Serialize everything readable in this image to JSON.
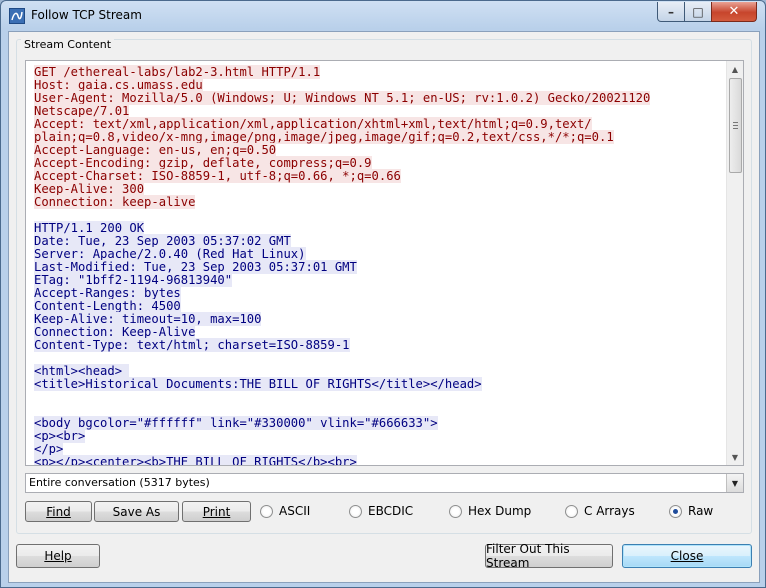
{
  "window": {
    "title": "Follow TCP Stream",
    "min_glyph": "–",
    "max_glyph": "□",
    "close_glyph": "✕"
  },
  "group": {
    "label": "Stream Content"
  },
  "stream": {
    "request": [
      "GET /ethereal-labs/lab2-3.html HTTP/1.1",
      "Host: gaia.cs.umass.edu",
      "User-Agent: Mozilla/5.0 (Windows; U; Windows NT 5.1; en-US; rv:1.0.2) Gecko/20021120",
      "Netscape/7.01",
      "Accept: text/xml,application/xml,application/xhtml+xml,text/html;q=0.9,text/",
      "plain;q=0.8,video/x-mng,image/png,image/jpeg,image/gif;q=0.2,text/css,*/*;q=0.1",
      "Accept-Language: en-us, en;q=0.50",
      "Accept-Encoding: gzip, deflate, compress;q=0.9",
      "Accept-Charset: ISO-8859-1, utf-8;q=0.66, *;q=0.66",
      "Keep-Alive: 300",
      "Connection: keep-alive"
    ],
    "response_headers": [
      "HTTP/1.1 200 OK",
      "Date: Tue, 23 Sep 2003 05:37:02 GMT",
      "Server: Apache/2.0.40 (Red Hat Linux)",
      "Last-Modified: Tue, 23 Sep 2003 05:37:01 GMT",
      "ETag: \"1bff2-1194-96813940\"",
      "Accept-Ranges: bytes",
      "Content-Length: 4500",
      "Keep-Alive: timeout=10, max=100",
      "Connection: Keep-Alive",
      "Content-Type: text/html; charset=ISO-8859-1"
    ],
    "response_body_1": [
      "<html><head> ",
      "<title>Historical Documents:THE BILL OF RIGHTS</title></head>"
    ],
    "response_body_2": [
      "<body bgcolor=\"#ffffff\" link=\"#330000\" vlink=\"#666633\">",
      "<p><br>",
      "</p>",
      "<p></p><center><b>THE BILL OF RIGHTS</b><br>"
    ]
  },
  "conversation_select": {
    "value": "Entire conversation (5317 bytes)"
  },
  "toolbar": {
    "find": "Find",
    "save_as": "Save As",
    "print": "Print"
  },
  "formats": [
    {
      "label": "ASCII",
      "selected": false
    },
    {
      "label": "EBCDIC",
      "selected": false
    },
    {
      "label": "Hex Dump",
      "selected": false
    },
    {
      "label": "C Arrays",
      "selected": false
    },
    {
      "label": "Raw",
      "selected": true
    }
  ],
  "footer": {
    "help": "Help",
    "filter_out": "Filter Out This Stream",
    "close": "Close"
  },
  "colors": {
    "client_bg": "#000080",
    "server_bg": "#8b0000"
  }
}
